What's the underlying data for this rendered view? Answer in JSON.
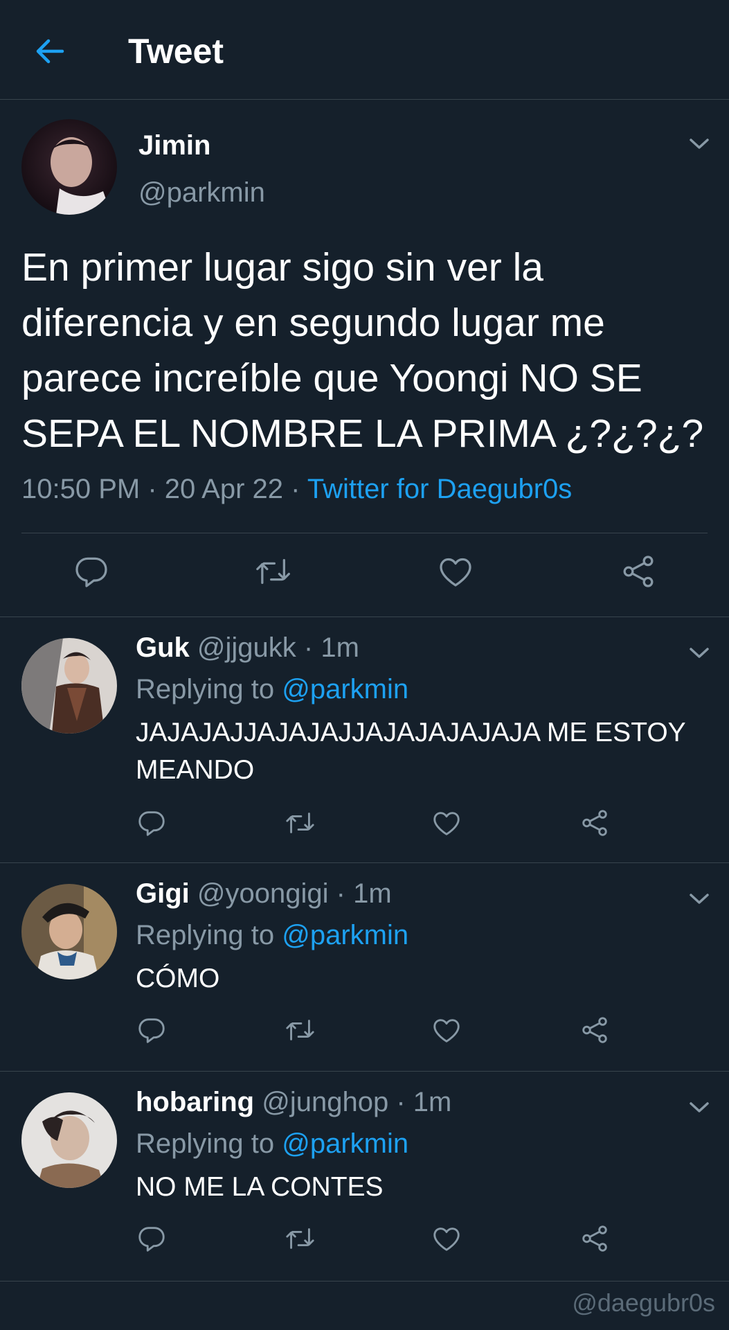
{
  "header": {
    "title": "Tweet"
  },
  "main_tweet": {
    "name": "Jimin",
    "handle": "@parkmin",
    "text": "En primer lugar sigo sin ver la diferencia  y en segundo lugar me parece increíble que Yoongi NO SE SEPA EL NOMBRE LA PRIMA ¿?¿?¿?",
    "time": "10:50 PM",
    "date": "20 Apr 22",
    "source": "Twitter for Daegubr0s"
  },
  "replies": [
    {
      "name": "Guk",
      "handle": "@jjgukk",
      "time": "1m",
      "replying_label": "Replying to",
      "replying_to": "@parkmin",
      "text": "JAJAJAJJAJAJAJJAJAJAJAJAJA ME ESTOY MEANDO"
    },
    {
      "name": "Gigi",
      "handle": "@yoongigi",
      "time": "1m",
      "replying_label": "Replying to",
      "replying_to": "@parkmin",
      "text": "CÓMO"
    },
    {
      "name": "hobaring",
      "handle": "@junghop",
      "time": "1m",
      "replying_label": "Replying to",
      "replying_to": "@parkmin",
      "text": "NO ME LA CONTES"
    }
  ],
  "icons": [
    "back-arrow-icon",
    "chevron-down-icon",
    "reply-icon",
    "retweet-icon",
    "like-icon",
    "share-icon"
  ],
  "colors": {
    "background": "#15202b",
    "accent": "#1da1f2",
    "secondary_text": "#8899a6",
    "divider": "#38444d"
  },
  "watermark": "@daegubr0s"
}
